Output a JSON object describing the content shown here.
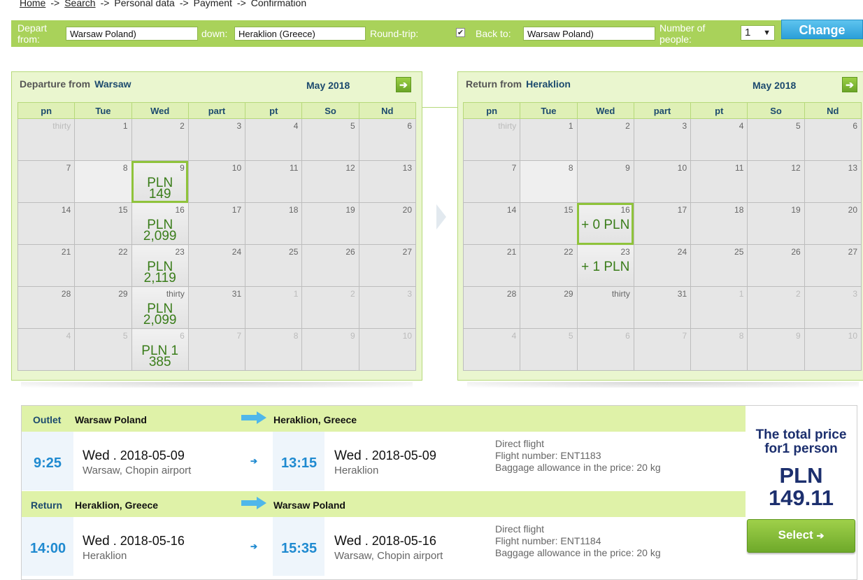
{
  "breadcrumb": {
    "items": [
      "Home",
      "Search",
      "Personal data",
      "Payment",
      "Confirmation"
    ],
    "separator": "->"
  },
  "search": {
    "depart_label": "Depart from:",
    "depart_value": "Warsaw Poland)",
    "down_label": "down:",
    "down_value": "Heraklion (Greece)",
    "roundtrip_label": "Round-trip:",
    "roundtrip_checked": true,
    "backto_label": "Back to:",
    "backto_value": "Warsaw Poland)",
    "people_label": "Number of people:",
    "people_value": "1",
    "change_label": "Change"
  },
  "weekdays": [
    "pn",
    "Tue",
    "Wed",
    "part",
    "pt",
    "So",
    "Nd"
  ],
  "departure_cal": {
    "title": "Departure from",
    "city": "Warsaw",
    "month": "May 2018",
    "weeks": [
      [
        {
          "d": "thirty",
          "o": true
        },
        {
          "d": "1"
        },
        {
          "d": "2"
        },
        {
          "d": "3"
        },
        {
          "d": "4"
        },
        {
          "d": "5"
        },
        {
          "d": "6"
        }
      ],
      [
        {
          "d": "7"
        },
        {
          "d": "8",
          "hl": true
        },
        {
          "d": "9",
          "p": "PLN 149",
          "sel": true
        },
        {
          "d": "10"
        },
        {
          "d": "11"
        },
        {
          "d": "12"
        },
        {
          "d": "13"
        }
      ],
      [
        {
          "d": "14"
        },
        {
          "d": "15"
        },
        {
          "d": "16",
          "p": "PLN 2,099"
        },
        {
          "d": "17"
        },
        {
          "d": "18"
        },
        {
          "d": "19"
        },
        {
          "d": "20"
        }
      ],
      [
        {
          "d": "21"
        },
        {
          "d": "22"
        },
        {
          "d": "23",
          "p": "PLN 2,119"
        },
        {
          "d": "24"
        },
        {
          "d": "25"
        },
        {
          "d": "26"
        },
        {
          "d": "27"
        }
      ],
      [
        {
          "d": "28"
        },
        {
          "d": "29"
        },
        {
          "d": "thirty",
          "p": "PLN 2,099"
        },
        {
          "d": "31"
        },
        {
          "d": "1",
          "o": true
        },
        {
          "d": "2",
          "o": true
        },
        {
          "d": "3",
          "o": true
        }
      ],
      [
        {
          "d": "4",
          "o": true
        },
        {
          "d": "5",
          "o": true
        },
        {
          "d": "6",
          "o": true,
          "p": "PLN 1 385"
        },
        {
          "d": "7",
          "o": true
        },
        {
          "d": "8",
          "o": true
        },
        {
          "d": "9",
          "o": true
        },
        {
          "d": "10",
          "o": true
        }
      ]
    ]
  },
  "return_cal": {
    "title": "Return from",
    "city": "Heraklion",
    "month": "May 2018",
    "weeks": [
      [
        {
          "d": "thirty",
          "o": true
        },
        {
          "d": "1"
        },
        {
          "d": "2"
        },
        {
          "d": "3"
        },
        {
          "d": "4"
        },
        {
          "d": "5"
        },
        {
          "d": "6"
        }
      ],
      [
        {
          "d": "7"
        },
        {
          "d": "8",
          "hl": true
        },
        {
          "d": "9"
        },
        {
          "d": "10"
        },
        {
          "d": "11"
        },
        {
          "d": "12"
        },
        {
          "d": "13"
        }
      ],
      [
        {
          "d": "14"
        },
        {
          "d": "15"
        },
        {
          "d": "16",
          "p": "+ 0 PLN",
          "sel": true
        },
        {
          "d": "17"
        },
        {
          "d": "18"
        },
        {
          "d": "19"
        },
        {
          "d": "20"
        }
      ],
      [
        {
          "d": "21"
        },
        {
          "d": "22"
        },
        {
          "d": "23",
          "p": "+ 1 PLN"
        },
        {
          "d": "24"
        },
        {
          "d": "25"
        },
        {
          "d": "26"
        },
        {
          "d": "27"
        }
      ],
      [
        {
          "d": "28"
        },
        {
          "d": "29"
        },
        {
          "d": "thirty"
        },
        {
          "d": "31"
        },
        {
          "d": "1",
          "o": true
        },
        {
          "d": "2",
          "o": true
        },
        {
          "d": "3",
          "o": true
        }
      ],
      [
        {
          "d": "4",
          "o": true
        },
        {
          "d": "5",
          "o": true
        },
        {
          "d": "6",
          "o": true
        },
        {
          "d": "7",
          "o": true
        },
        {
          "d": "8",
          "o": true
        },
        {
          "d": "9",
          "o": true
        },
        {
          "d": "10",
          "o": true
        }
      ]
    ]
  },
  "outlet": {
    "label": "Outlet",
    "from": "Warsaw Poland",
    "to": "Heraklion, Greece",
    "dep_time": "9:25",
    "dep_dow": "Wed",
    "dep_date": ". 2018-05-09",
    "dep_place": "Warsaw, Chopin airport",
    "arr_time": "13:15",
    "arr_dow": "Wed",
    "arr_date": ". 2018-05-09",
    "arr_place": "Heraklion",
    "info1": "Direct flight",
    "info2": "Flight number: ENT1183",
    "info3": "Baggage allowance in the price: 20 kg"
  },
  "return": {
    "label": "Return",
    "from": "Heraklion, Greece",
    "to": "Warsaw Poland",
    "dep_time": "14:00",
    "dep_dow": "Wed",
    "dep_date": ". 2018-05-16",
    "dep_place": "Heraklion",
    "arr_time": "15:35",
    "arr_dow": "Wed",
    "arr_date": ". 2018-05-16",
    "arr_place": "Warsaw, Chopin airport",
    "info1": "Direct flight",
    "info2": "Flight number: ENT1184",
    "info3": "Baggage allowance in the price: 20 kg"
  },
  "total": {
    "title1": "The total price",
    "title2": "for1 person",
    "currency": "PLN",
    "amount": "149.11",
    "select_label": "Select"
  },
  "colors": {
    "accent_green": "#a9d25a",
    "price_green": "#3a7d1a",
    "navy": "#1c4a6e",
    "blue": "#1f8ad0"
  }
}
